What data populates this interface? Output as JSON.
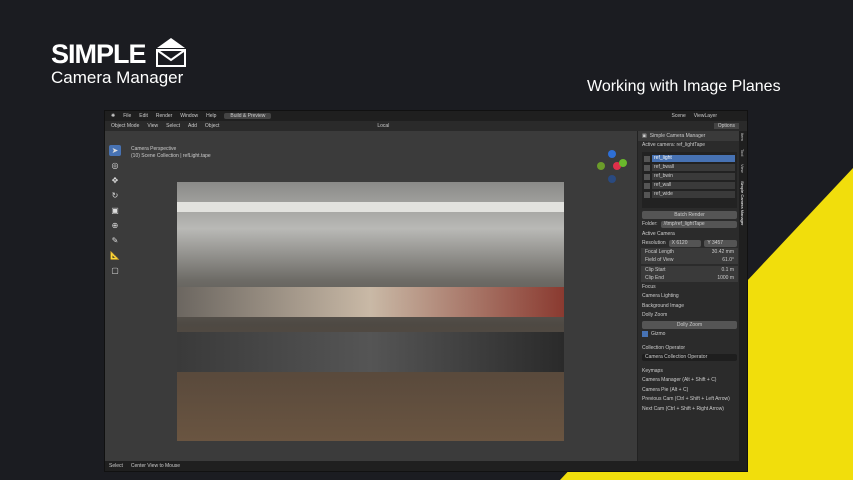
{
  "brand": {
    "name": "SIMPLE",
    "product": "Camera Manager"
  },
  "headline": "Working with Image Planes",
  "colors": {
    "accent_yellow": "#f1de0c",
    "blender_blue": "#4772b3"
  },
  "blender": {
    "menu": [
      "File",
      "Edit",
      "Render",
      "Window",
      "Help"
    ],
    "workspace_tab": "Build & Preview",
    "header": {
      "mode": "Object Mode",
      "menus": [
        "View",
        "Select",
        "Add",
        "Object"
      ],
      "transform": "Local",
      "scene": "Scene",
      "view_layer": "ViewLayer",
      "options": "Options"
    },
    "viewport_info": {
      "line1": "Camera Perspective",
      "line2": "(10) Scene Collection | refLight.tape"
    },
    "panel": {
      "title": "Simple Camera Manager",
      "active_camera_label": "Active camera: ref_lightTape",
      "cameras": [
        "ref_light",
        "ref_bwall",
        "ref_bwin",
        "ref_wall",
        "ref_wide"
      ],
      "batch_render": "Batch Render",
      "folder_label": "Folder:",
      "folder_value": "//tmp/ref_lightTape",
      "active_camera_section": "Active Camera",
      "resolution_label": "Resolution",
      "res_x": "X 6120",
      "res_y": "Y 3457",
      "focal_length_label": "Focal Length",
      "focal_length": "30.42 mm",
      "fov_label": "Field of View",
      "fov": "61.0°",
      "clip_start_label": "Clip Start",
      "clip_start": "0.1 m",
      "clip_end_label": "Clip End",
      "clip_end": "1000 m",
      "sections": [
        "Focus",
        "Camera Lighting",
        "Background Image"
      ],
      "dolly_zoom_section": "Dolly Zoom",
      "dolly_zoom_button": "Dolly Zoom",
      "gizmo_label": "Gizmo",
      "collection_operator_label": "Collection Operator",
      "collection_operator_value": "Camera Collection Operator",
      "keymaps_label": "Keymaps",
      "keymaps": [
        "Camera Manager (Alt + Shift + C)",
        "Camera Pie (Alt + C)",
        "Previous Cam (Ctrl + Shift + Left Arrow)",
        "Next Cam (Ctrl + Shift + Right Arrow)"
      ]
    },
    "sidetabs": [
      "Item",
      "Tool",
      "View",
      "Simple Camera Manager"
    ],
    "status": [
      "Select",
      "Center View to Mouse"
    ]
  }
}
